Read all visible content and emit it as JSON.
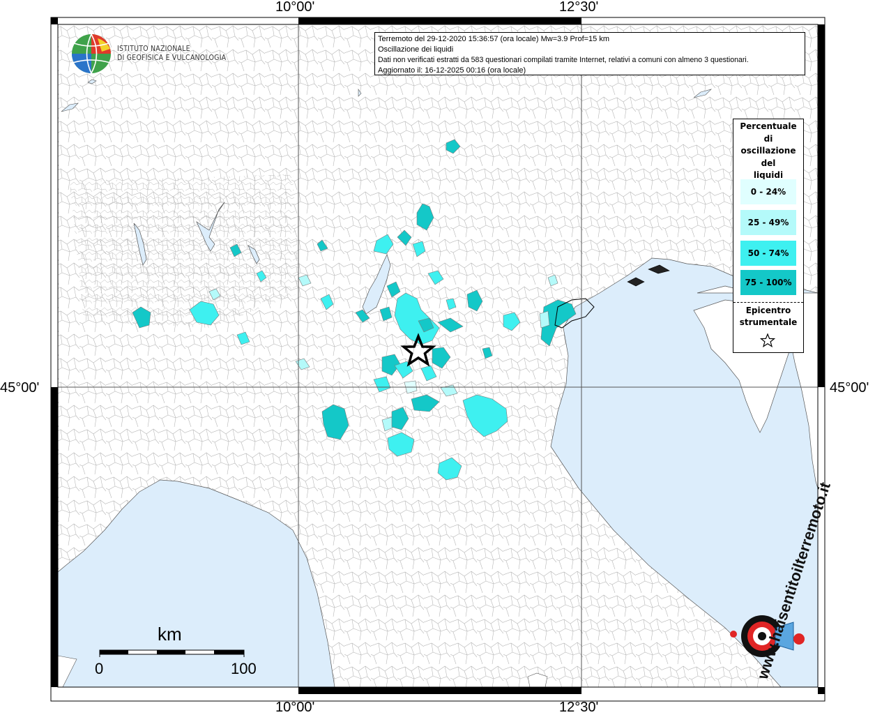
{
  "coordinates": {
    "lon_left": "10°00'",
    "lon_right": "12°30'",
    "lat": "45°00'"
  },
  "logo": {
    "line1": "ISTITUTO NAZIONALE",
    "line2": "DI GEOFISICA E VULCANOLOGIA"
  },
  "info": {
    "line1": "Terremoto del 29-12-2020 15:36:57 (ora locale) Mw=3.9 Prof=15 km",
    "line2": "Oscillazione dei liquidi",
    "line3": "Dati non verificati estratti da 583 questionari compilati tramite Internet, relativi a comuni con almeno 3 questionari.",
    "line4": "Aggiornato il: 16-12-2025 00:16 (ora locale)"
  },
  "legend": {
    "title_lines": [
      "Percentuale",
      "di",
      "oscillazione",
      "del",
      "liquidi"
    ],
    "items": [
      {
        "label": "0 - 24%",
        "color": "#e0ffff"
      },
      {
        "label": "25 - 49%",
        "color": "#b4fafa"
      },
      {
        "label": "50 - 74%",
        "color": "#3ef0f0"
      },
      {
        "label": "75 - 100%",
        "color": "#14c8c8"
      }
    ],
    "epicenter_line1": "Epicentro",
    "epicenter_line2": "strumentale"
  },
  "scale": {
    "unit": "km",
    "min": "0",
    "max": "100"
  },
  "colors": {
    "sea": "#dcedfb",
    "land": "#ffffff",
    "border": "#b0b0b0"
  },
  "watermark": {
    "text": "www.haisentitoilterremoto.it"
  }
}
